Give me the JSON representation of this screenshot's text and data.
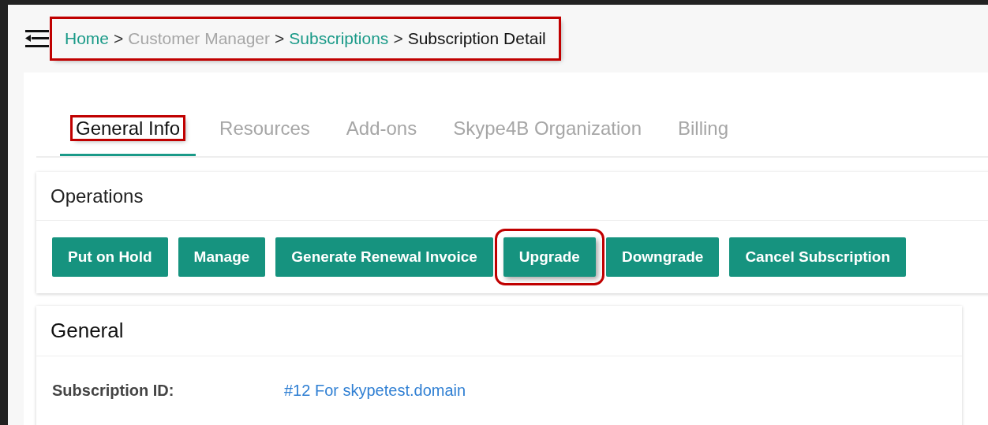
{
  "breadcrumb": {
    "highlighted": true,
    "separator": ">",
    "items": [
      {
        "label": "Home",
        "kind": "link"
      },
      {
        "label": "Customer Manager",
        "kind": "muted"
      },
      {
        "label": "Subscriptions",
        "kind": "link"
      },
      {
        "label": "Subscription Detail",
        "kind": "current"
      }
    ]
  },
  "tabs": [
    {
      "label": "General Info",
      "selected": true,
      "highlighted": true
    },
    {
      "label": "Resources",
      "selected": false,
      "highlighted": false
    },
    {
      "label": "Add-ons",
      "selected": false,
      "highlighted": false
    },
    {
      "label": "Skype4B Organization",
      "selected": false,
      "highlighted": false
    },
    {
      "label": "Billing",
      "selected": false,
      "highlighted": false
    }
  ],
  "operations": {
    "title": "Operations",
    "buttons": [
      {
        "label": "Put on Hold",
        "highlighted": false
      },
      {
        "label": "Manage",
        "highlighted": false
      },
      {
        "label": "Generate Renewal Invoice",
        "highlighted": false
      },
      {
        "label": "Upgrade",
        "highlighted": true
      },
      {
        "label": "Downgrade",
        "highlighted": false
      },
      {
        "label": "Cancel Subscription",
        "highlighted": false
      }
    ]
  },
  "general": {
    "title": "General",
    "fields": [
      {
        "label": "Subscription ID:",
        "value": "#12 For skypetest.domain"
      }
    ]
  }
}
